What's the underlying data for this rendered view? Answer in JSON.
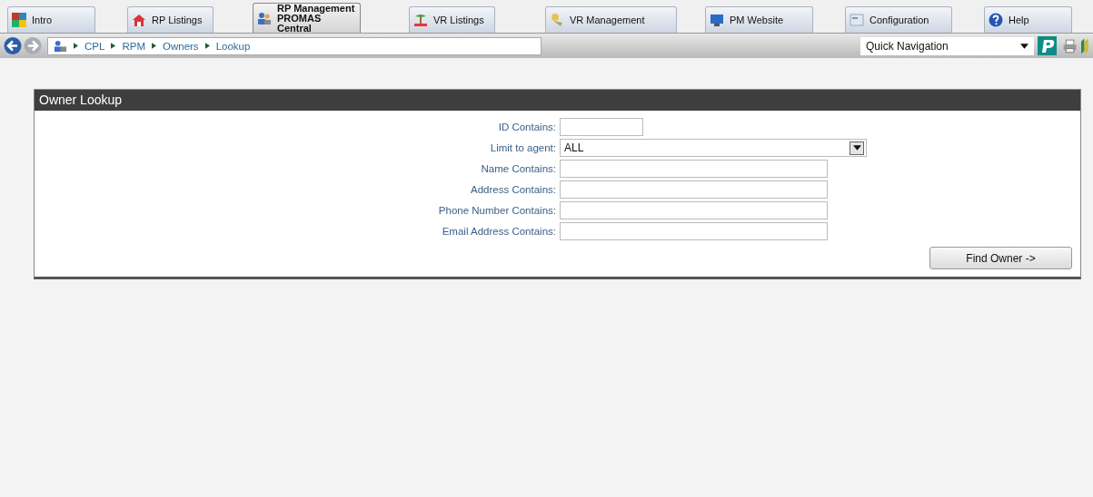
{
  "tabs": [
    {
      "label": "Intro",
      "kind": "logo",
      "selected": false
    },
    {
      "label": "RP Listings",
      "kind": "house",
      "selected": false
    },
    {
      "label": "RP Management PROMAS Central",
      "kind": "people",
      "selected": true
    },
    {
      "label": "VR Listings",
      "kind": "palm",
      "selected": false
    },
    {
      "label": "VR Management",
      "kind": "sun",
      "selected": false
    },
    {
      "label": "PM Website",
      "kind": "monitor",
      "selected": false
    },
    {
      "label": "Configuration",
      "kind": "config",
      "selected": false
    },
    {
      "label": "Help",
      "kind": "help",
      "selected": false
    }
  ],
  "breadcrumb": [
    "CPL",
    "RPM",
    "Owners",
    "Lookup"
  ],
  "quick_navigation": {
    "value": "Quick Navigation"
  },
  "panel": {
    "title": "Owner Lookup",
    "fields": [
      {
        "label": "ID Contains:",
        "kind": "short"
      },
      {
        "label": "Limit to agent:",
        "kind": "select",
        "value": "ALL"
      },
      {
        "label": "Name Contains:",
        "kind": "text"
      },
      {
        "label": "Address Contains:",
        "kind": "text"
      },
      {
        "label": "Phone Number Contains:",
        "kind": "text"
      },
      {
        "label": "Email Address Contains:",
        "kind": "text"
      }
    ],
    "button": "Find Owner ->"
  }
}
